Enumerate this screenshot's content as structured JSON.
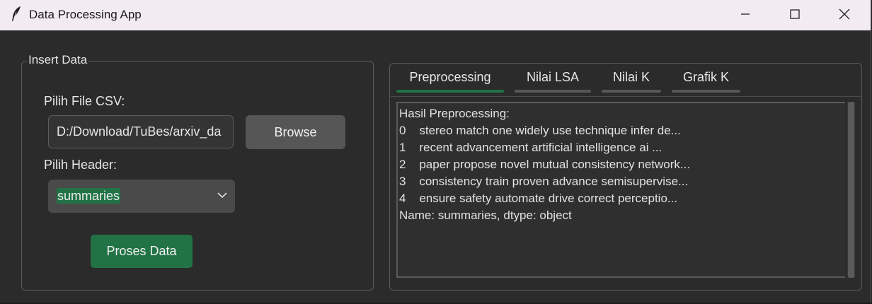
{
  "window": {
    "title": "Data Processing App",
    "icon": "feather-icon",
    "controls": [
      "minimize-icon",
      "maximize-icon",
      "close-icon"
    ]
  },
  "insert_data": {
    "group_title": "Insert Data",
    "csv_label": "Pilih File CSV:",
    "csv_path": "D:/Download/TuBes/arxiv_da",
    "browse_label": "Browse",
    "header_label": "Pilih Header:",
    "header_selected": "summaries",
    "process_label": "Proses Data"
  },
  "tabs": [
    {
      "label": "Preprocessing",
      "active": true
    },
    {
      "label": "Nilai LSA",
      "active": false
    },
    {
      "label": "Nilai K",
      "active": false
    },
    {
      "label": "Grafik K",
      "active": false
    }
  ],
  "output": {
    "lines": [
      "Hasil Preprocessing:",
      "0    stereo match one widely use technique infer de...",
      "1    recent advancement artificial intelligence ai ...",
      "2    paper propose novel mutual consistency network...",
      "3    consistency train proven advance semisupervise...",
      "4    ensure safety automate drive correct perceptio...",
      "Name: summaries, dtype: object"
    ]
  },
  "colors": {
    "accent": "#217346",
    "background": "#2b2b2b",
    "titlebar": "#f2ecf2"
  }
}
